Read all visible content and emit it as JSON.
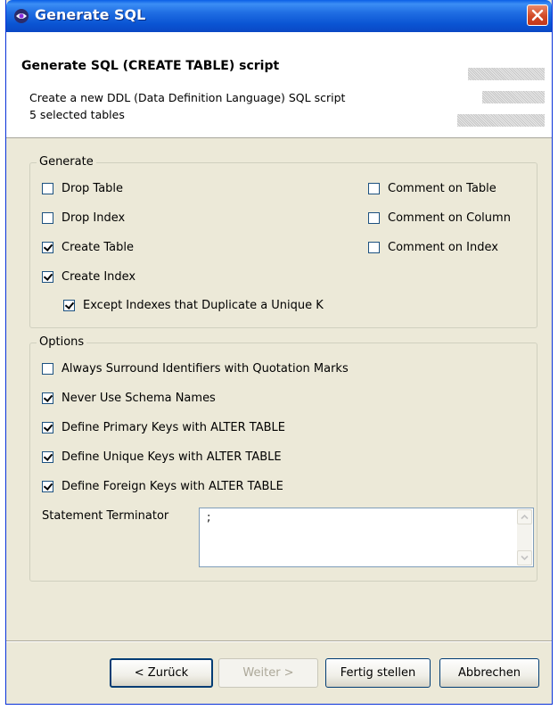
{
  "window": {
    "title": "Generate SQL"
  },
  "banner": {
    "title": "Generate SQL (CREATE TABLE) script",
    "description_line1": "Create a new DDL (Data Definition Language) SQL script",
    "description_line2": "5 selected tables"
  },
  "generate": {
    "label": "Generate",
    "items": [
      {
        "label": "Drop Table",
        "checked": false
      },
      {
        "label": "Drop Index",
        "checked": false
      },
      {
        "label": "Create Table",
        "checked": true
      },
      {
        "label": "Create Index",
        "checked": true
      },
      {
        "label": "Except Indexes that Duplicate a Unique K",
        "checked": true
      },
      {
        "label": "Comment on Table",
        "checked": false
      },
      {
        "label": "Comment on Column",
        "checked": false
      },
      {
        "label": "Comment on Index",
        "checked": false
      }
    ]
  },
  "options": {
    "label": "Options",
    "items": [
      {
        "label": "Always Surround Identifiers with Quotation Marks",
        "checked": false
      },
      {
        "label": "Never Use Schema Names",
        "checked": true
      },
      {
        "label": "Define Primary Keys with ALTER TABLE",
        "checked": true
      },
      {
        "label": "Define Unique Keys with ALTER TABLE",
        "checked": true
      },
      {
        "label": "Define Foreign Keys with ALTER TABLE",
        "checked": true
      }
    ],
    "terminator_label": "Statement Terminator",
    "terminator_value": ";"
  },
  "buttons": {
    "back": "< Zurück",
    "next": "Weiter >",
    "finish": "Fertig stellen",
    "cancel": "Abbrechen"
  },
  "colors": {
    "titlebar": "#0a54d3",
    "dialog_bg": "#ece9d8",
    "checkmark": "#21a121"
  }
}
